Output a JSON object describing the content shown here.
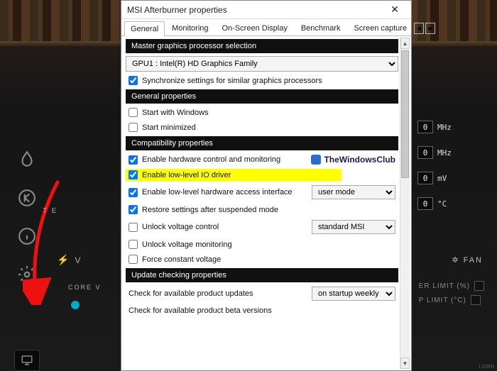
{
  "dialog": {
    "title": "MSI Afterburner properties",
    "tabs": [
      "General",
      "Monitoring",
      "On-Screen Display",
      "Benchmark",
      "Screen capture"
    ],
    "active_tab": 0,
    "sections": {
      "master": "Master graphics processor selection",
      "gpu_selected": "GPU1 : Intel(R) HD Graphics Family",
      "sync_label": "Synchronize settings for similar graphics processors",
      "general_props": "General properties",
      "start_windows": "Start with Windows",
      "start_min": "Start minimized",
      "compat_props": "Compatibility properties",
      "enable_hw": "Enable hardware control and monitoring",
      "enable_io": "Enable low-level IO driver",
      "enable_ll_hw": "Enable low-level hardware access interface",
      "ll_hw_mode": "user mode",
      "restore": "Restore settings after suspended mode",
      "unlock_v": "Unlock voltage control",
      "unlock_v_mode": "standard MSI",
      "unlock_vm": "Unlock voltage monitoring",
      "force_cv": "Force constant voltage",
      "update_props": "Update checking properties",
      "check_updates": "Check for available product updates",
      "check_updates_mode": "on startup weekly",
      "check_beta": "Check for available product beta versions"
    },
    "logo_text": "TheWindowsClub"
  },
  "bg": {
    "mhz_unit": "MHz",
    "mv_unit": "mV",
    "deg_unit": "°C",
    "zero": "0",
    "fan_label": "FAN",
    "power_limit": "ER LIMIT (%)",
    "temp_limit": "P LIMIT (°C)",
    "volt_label": "V",
    "core_v": "CORE V",
    "te_label": "T E"
  }
}
